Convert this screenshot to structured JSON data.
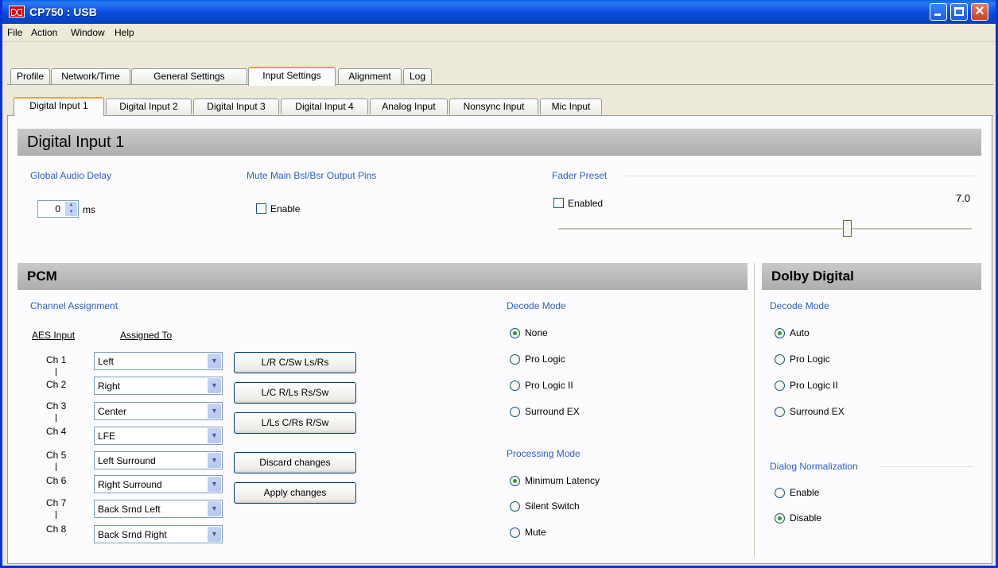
{
  "window": {
    "title": "CP750 : USB"
  },
  "menu": [
    "File",
    "Action",
    "Window",
    "Help"
  ],
  "main_tabs": [
    "Profile",
    "Network/Time",
    "General Settings",
    "Input Settings",
    "Alignment",
    "Log"
  ],
  "sub_tabs": [
    "Digital Input 1",
    "Digital Input 2",
    "Digital Input 3",
    "Digital Input 4",
    "Analog Input",
    "Nonsync Input",
    "Mic Input"
  ],
  "page_title": "Digital Input 1",
  "global_delay": {
    "label": "Global Audio Delay",
    "value": "0",
    "unit": "ms"
  },
  "mute_pins": {
    "label": "Mute Main Bsl/Bsr Output Pins",
    "checkbox_label": "Enable"
  },
  "fader_preset": {
    "label": "Fader Preset",
    "checkbox_label": "Enabled",
    "value": "7.0",
    "slider_fraction": 0.7
  },
  "pcm": {
    "title": "PCM",
    "channel_assignment_label": "Channel Assignment",
    "aes_input_header": "AES Input",
    "assigned_to_header": "Assigned To",
    "channels": [
      "Ch 1",
      "Ch 2",
      "Ch 3",
      "Ch 4",
      "Ch 5",
      "Ch 6",
      "Ch 7",
      "Ch 8"
    ],
    "assignments": [
      "Left",
      "Right",
      "Center",
      "LFE",
      "Left Surround",
      "Right Surround",
      "Back Srnd Left",
      "Back Srnd Right"
    ],
    "preset_buttons": [
      "L/R  C/Sw  Ls/Rs",
      "L/C  R/Ls  Rs/Sw",
      "L/Ls  C/Rs  R/Sw"
    ],
    "discard_label": "Discard changes",
    "apply_label": "Apply changes",
    "decode_mode_label": "Decode Mode",
    "decode_modes": [
      "None",
      "Pro Logic",
      "Pro Logic II",
      "Surround EX"
    ],
    "processing_mode_label": "Processing Mode",
    "processing_modes": [
      "Minimum Latency",
      "Silent Switch",
      "Mute"
    ]
  },
  "dolby": {
    "title": "Dolby Digital",
    "decode_mode_label": "Decode Mode",
    "decode_modes": [
      "Auto",
      "Pro Logic",
      "Pro Logic II",
      "Surround EX"
    ],
    "dialog_norm_label": "Dialog Normalization",
    "dialog_norm_options": [
      "Enable",
      "Disable"
    ]
  }
}
